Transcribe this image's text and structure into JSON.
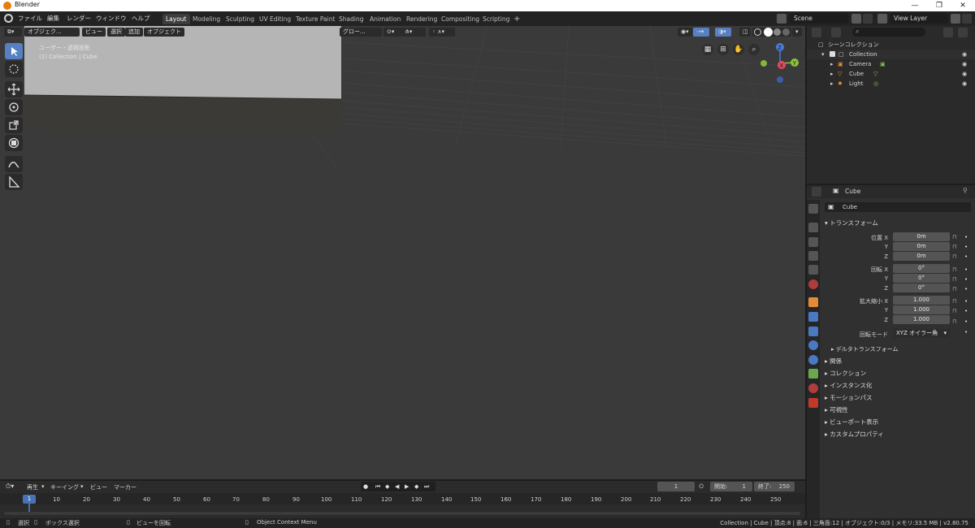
{
  "window": {
    "title": "Blender",
    "controls": [
      "—",
      "❐",
      "✕"
    ]
  },
  "menu": [
    "ファイル",
    "編集",
    "レンダー",
    "ウィンドウ",
    "ヘルプ"
  ],
  "workspaces": [
    "Layout",
    "Modeling",
    "Sculpting",
    "UV Editing",
    "Texture Paint",
    "Shading",
    "Animation",
    "Rendering",
    "Compositing",
    "Scripting"
  ],
  "workspace_add": "+",
  "scene_field": "Scene",
  "view_layer_field": "View Layer",
  "viewport": {
    "mode": "オブジェク...",
    "menus": [
      "ビュー",
      "選択",
      "追加",
      "オブジェクト"
    ],
    "orientation": "グロー...",
    "overlay_line1": "ユーザー・透視投影",
    "overlay_line2": "(1) Collection | Cube",
    "gizmo": {
      "z": "Z",
      "y": "Y",
      "x": "X"
    }
  },
  "outliner": {
    "search_placeholder": "",
    "scene_collection": "シーンコレクション",
    "collection": "Collection",
    "objects": [
      "Camera",
      "Cube",
      "Light"
    ]
  },
  "properties": {
    "header_object": "Cube",
    "name_field": "Cube",
    "transform_title": "トランスフォーム",
    "location": {
      "label": "位置 X",
      "x": "0m",
      "y": "0m",
      "z": "0m"
    },
    "rotation": {
      "label": "回転 X",
      "x": "0°",
      "y": "0°",
      "z": "0°"
    },
    "scale": {
      "label": "拡大縮小 X",
      "x": "1.000",
      "y": "1.000",
      "z": "1.000"
    },
    "axis_y": "Y",
    "axis_z": "Z",
    "rotation_mode_label": "回転モード",
    "rotation_mode_value": "XYZ オイラー角",
    "delta_transform": "デルタトランスフォーム",
    "panels": [
      "関係",
      "コレクション",
      "インスタンス化",
      "モーションパス",
      "可視性",
      "ビューポート表示",
      "カスタムプロパティ"
    ]
  },
  "timeline": {
    "menus": [
      "再生",
      "キーイング",
      "ビュー",
      "マーカー"
    ],
    "current_frame": "1",
    "start_label": "開始:",
    "start_value": "1",
    "end_label": "終了:",
    "end_value": "250",
    "ruler": [
      "1",
      "10",
      "20",
      "30",
      "40",
      "50",
      "60",
      "70",
      "80",
      "90",
      "100",
      "110",
      "120",
      "130",
      "140",
      "150",
      "160",
      "170",
      "180",
      "190",
      "200",
      "210",
      "220",
      "230",
      "240",
      "250"
    ]
  },
  "statusbar": {
    "select": "選択",
    "box_select": "ボックス選択",
    "rotate_view": "ビューを回転",
    "context_menu": "Object Context Menu",
    "stats": "Collection | Cube | 頂点:8 | 面:6 | 三角面:12 | オブジェクト:0/3 | メモリ:33.5 MB | v2.80.75"
  },
  "colors": {
    "accent": "#5680c2",
    "viewport_bg": "#3a3a3a",
    "panel_bg": "#303030"
  }
}
